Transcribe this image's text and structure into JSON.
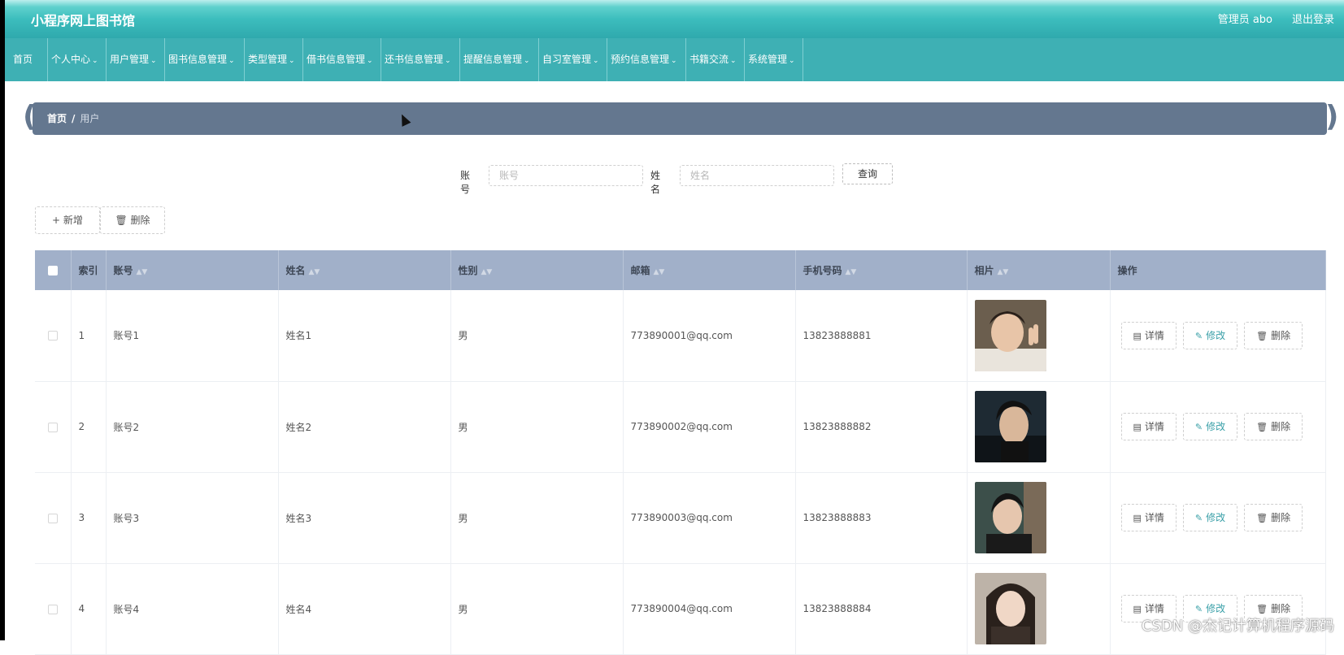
{
  "header": {
    "app_title": "小程序网上图书馆",
    "admin_label": "管理员 abo",
    "logout_label": "退出登录"
  },
  "nav": [
    {
      "label": "首页",
      "has_dropdown": false
    },
    {
      "label": "个人中心",
      "has_dropdown": true
    },
    {
      "label": "用户管理",
      "has_dropdown": true
    },
    {
      "label": "图书信息管理",
      "has_dropdown": true
    },
    {
      "label": "类型管理",
      "has_dropdown": true
    },
    {
      "label": "借书信息管理",
      "has_dropdown": true
    },
    {
      "label": "还书信息管理",
      "has_dropdown": true
    },
    {
      "label": "提醒信息管理",
      "has_dropdown": true
    },
    {
      "label": "自习室管理",
      "has_dropdown": true
    },
    {
      "label": "预约信息管理",
      "has_dropdown": true
    },
    {
      "label": "书籍交流",
      "has_dropdown": true
    },
    {
      "label": "系统管理",
      "has_dropdown": true
    }
  ],
  "breadcrumb": {
    "home": "首页",
    "separator": "/",
    "current": "用户"
  },
  "search": {
    "account_label": "账号",
    "account_placeholder": "账号",
    "name_label": "姓名",
    "name_placeholder": "姓名",
    "query_button": "查询"
  },
  "actions": {
    "add": "新增",
    "delete": "删除"
  },
  "table": {
    "headers": [
      "索引",
      "账号",
      "姓名",
      "性别",
      "邮箱",
      "手机号码",
      "相片",
      "操作"
    ],
    "rows": [
      {
        "index": "1",
        "account": "账号1",
        "name": "姓名1",
        "gender": "男",
        "email": "773890001@qq.com",
        "phone": "13823888881"
      },
      {
        "index": "2",
        "account": "账号2",
        "name": "姓名2",
        "gender": "男",
        "email": "773890002@qq.com",
        "phone": "13823888882"
      },
      {
        "index": "3",
        "account": "账号3",
        "name": "姓名3",
        "gender": "男",
        "email": "773890003@qq.com",
        "phone": "13823888883"
      },
      {
        "index": "4",
        "account": "账号4",
        "name": "姓名4",
        "gender": "男",
        "email": "773890004@qq.com",
        "phone": "13823888884"
      }
    ],
    "row_actions": {
      "detail": "详情",
      "edit": "修改",
      "delete": "删除"
    }
  },
  "watermark": "CSDN @杰记计算机程序源码",
  "colors": {
    "header_teal": "#3cbdbd",
    "nav_teal": "#3eb0b4",
    "breadcrumb_bg": "#64778f",
    "table_header_bg": "#a1b0c9"
  }
}
